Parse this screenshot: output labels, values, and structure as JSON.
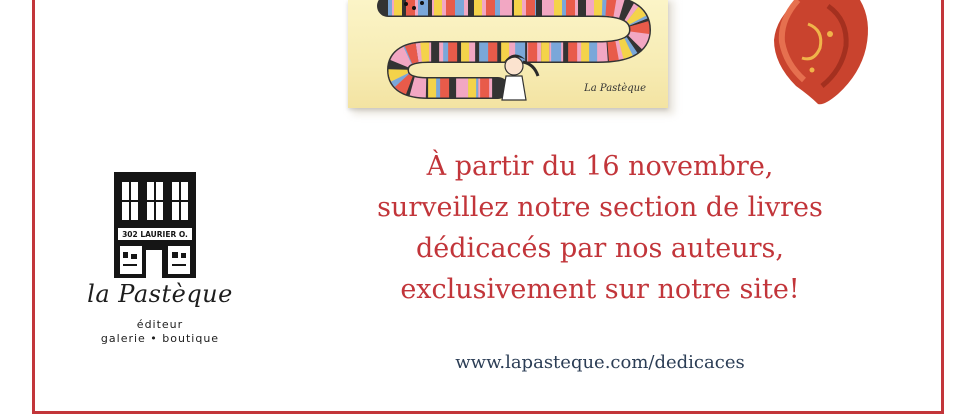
{
  "book_cover": {
    "publisher_label": "La Pastèque"
  },
  "logo": {
    "address": "302 LAURIER O.",
    "wordmark": "la Pastèque",
    "subtitle_1": "éditeur",
    "subtitle_2": "galerie • boutique"
  },
  "announcement": {
    "lines": [
      "À partir du 16 novembre,",
      "surveillez notre section de livres",
      "dédicacés par nos auteurs,",
      "exclusivement sur notre site!"
    ],
    "url": "www.lapasteque.com/dedicaces"
  },
  "colors": {
    "accent_red": "#c2353a",
    "url_navy": "#2b3d55",
    "frame_red": "#c2353a"
  }
}
